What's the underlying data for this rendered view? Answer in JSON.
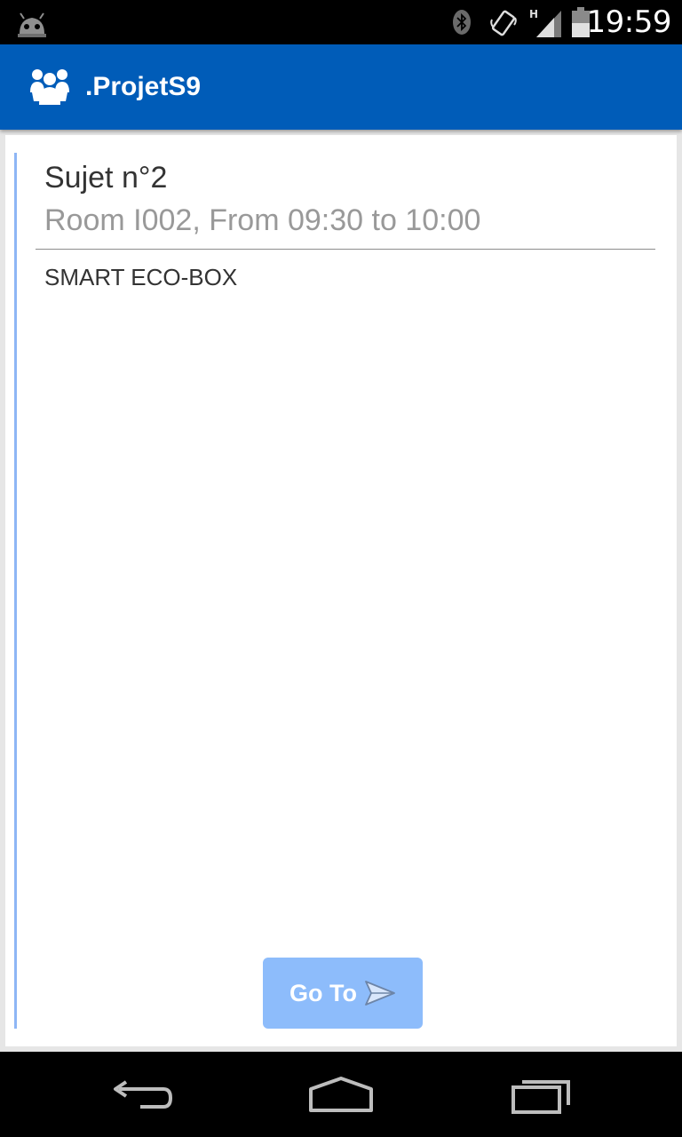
{
  "status_bar": {
    "time": "19:59",
    "icons": [
      "android-debug-icon",
      "bluetooth-icon",
      "vibrate-icon",
      "signal-h-icon",
      "battery-icon"
    ],
    "network_type": "H"
  },
  "action_bar": {
    "title": ".ProjetS9",
    "icon": "people-group-icon",
    "background_color": "#005cb8"
  },
  "subject": {
    "title": "Sujet n°2",
    "meta": "Room I002, From 09:30 to 10:00",
    "description": "SMART ECO-BOX"
  },
  "goto_button": {
    "label": "Go To",
    "icon": "send-icon",
    "color": "#8dbcfb"
  },
  "nav_bar": {
    "icons": [
      "back-icon",
      "home-icon",
      "recents-icon"
    ]
  },
  "colors": {
    "accent_line": "#8eb6f5",
    "meta_text": "#999999"
  }
}
